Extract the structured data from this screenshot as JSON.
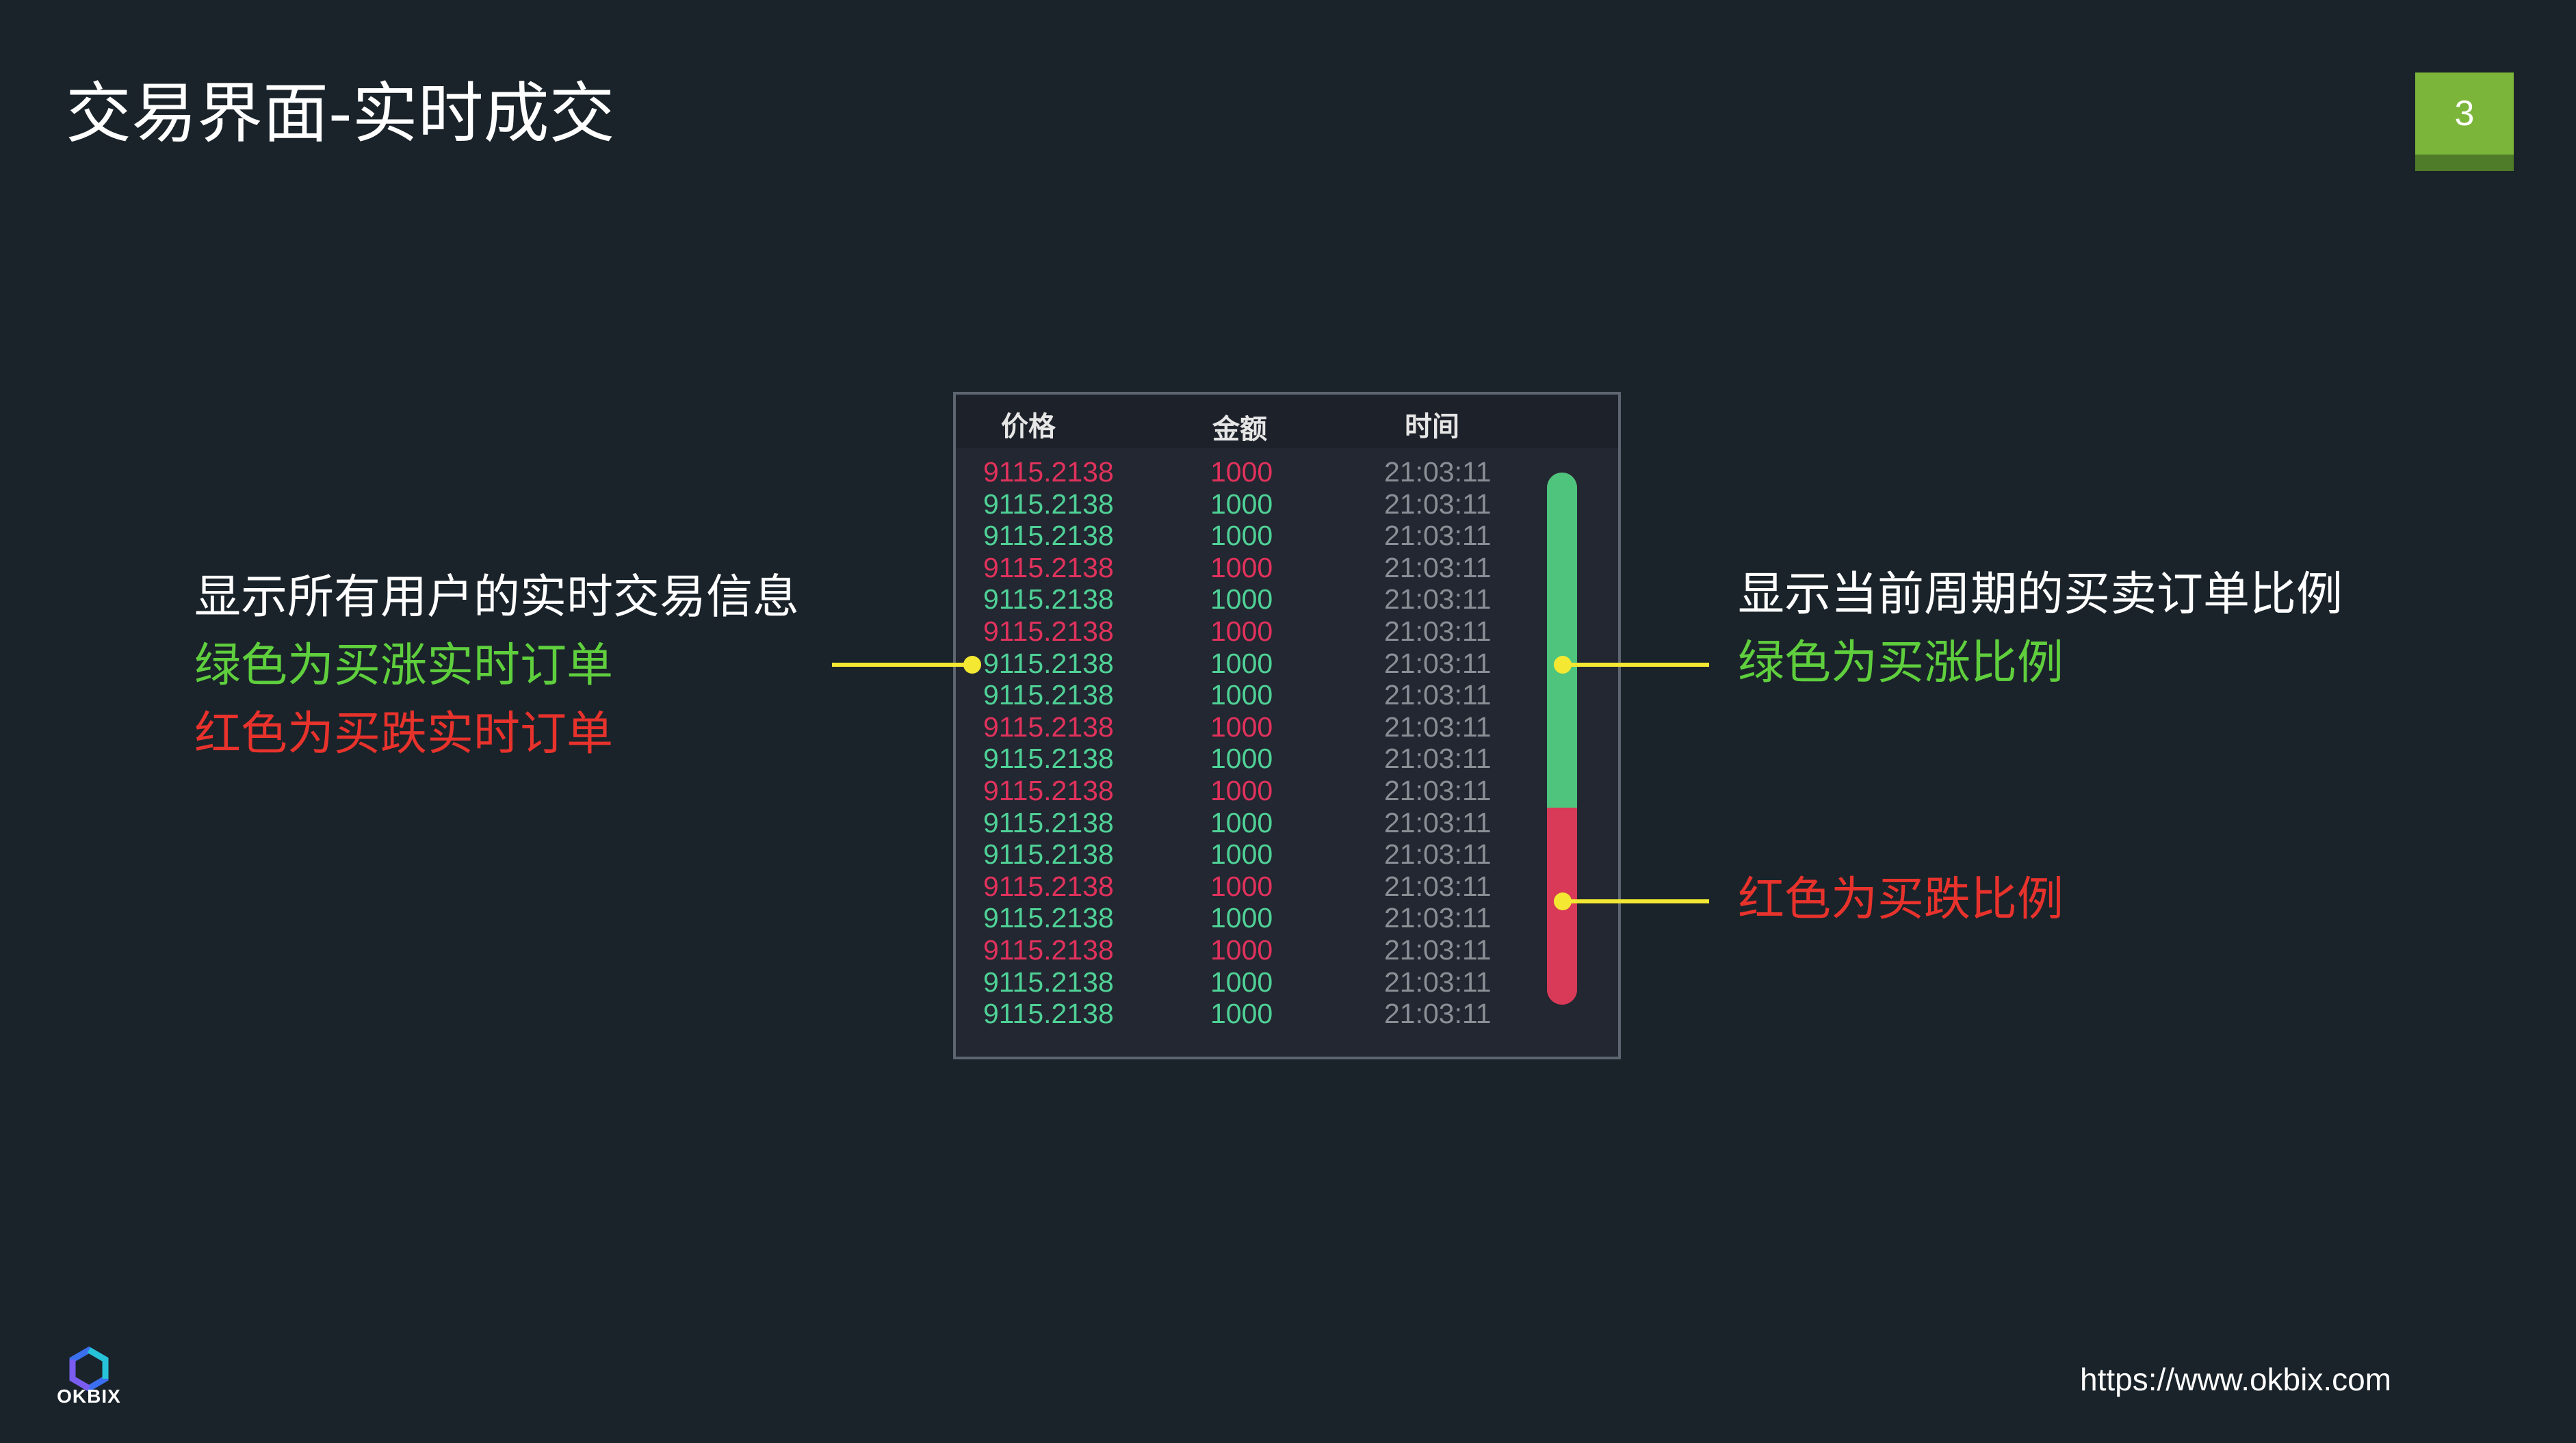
{
  "slide": {
    "title": "交易界面-实时成交",
    "page_number": "3"
  },
  "left_description": {
    "line1": "显示所有用户的实时交易信息",
    "line2": "绿色为买涨实时订单",
    "line3": "红色为买跌实时订单"
  },
  "right_description": {
    "line1": "显示当前周期的买卖订单比例",
    "line2": "绿色为买涨比例",
    "line3": "红色为买跌比例"
  },
  "trade_panel": {
    "columns": {
      "price": "价格",
      "amount": "金额",
      "time": "时间"
    },
    "rows": [
      {
        "side": "sell",
        "price": "9115.2138",
        "amount": "1000",
        "time": "21:03:11"
      },
      {
        "side": "buy",
        "price": "9115.2138",
        "amount": "1000",
        "time": "21:03:11"
      },
      {
        "side": "buy",
        "price": "9115.2138",
        "amount": "1000",
        "time": "21:03:11"
      },
      {
        "side": "sell",
        "price": "9115.2138",
        "amount": "1000",
        "time": "21:03:11"
      },
      {
        "side": "buy",
        "price": "9115.2138",
        "amount": "1000",
        "time": "21:03:11"
      },
      {
        "side": "sell",
        "price": "9115.2138",
        "amount": "1000",
        "time": "21:03:11"
      },
      {
        "side": "buy",
        "price": "9115.2138",
        "amount": "1000",
        "time": "21:03:11"
      },
      {
        "side": "buy",
        "price": "9115.2138",
        "amount": "1000",
        "time": "21:03:11"
      },
      {
        "side": "sell",
        "price": "9115.2138",
        "amount": "1000",
        "time": "21:03:11"
      },
      {
        "side": "buy",
        "price": "9115.2138",
        "amount": "1000",
        "time": "21:03:11"
      },
      {
        "side": "sell",
        "price": "9115.2138",
        "amount": "1000",
        "time": "21:03:11"
      },
      {
        "side": "buy",
        "price": "9115.2138",
        "amount": "1000",
        "time": "21:03:11"
      },
      {
        "side": "buy",
        "price": "9115.2138",
        "amount": "1000",
        "time": "21:03:11"
      },
      {
        "side": "sell",
        "price": "9115.2138",
        "amount": "1000",
        "time": "21:03:11"
      },
      {
        "side": "buy",
        "price": "9115.2138",
        "amount": "1000",
        "time": "21:03:11"
      },
      {
        "side": "sell",
        "price": "9115.2138",
        "amount": "1000",
        "time": "21:03:11"
      },
      {
        "side": "buy",
        "price": "9115.2138",
        "amount": "1000",
        "time": "21:03:11"
      },
      {
        "side": "buy",
        "price": "9115.2138",
        "amount": "1000",
        "time": "21:03:11"
      }
    ],
    "ratio": {
      "buy": 0.63,
      "sell": 0.37
    }
  },
  "colors": {
    "background": "#1a232a",
    "buy_green": "#4fd196",
    "sell_red": "#e0325c",
    "annotation_yellow": "#f4e833",
    "badge_green": "#7bb53a"
  },
  "logo": {
    "text": "OKBIX",
    "icon": "okbix-logo-icon"
  },
  "footer": {
    "url": "https://www.okbix.com"
  }
}
